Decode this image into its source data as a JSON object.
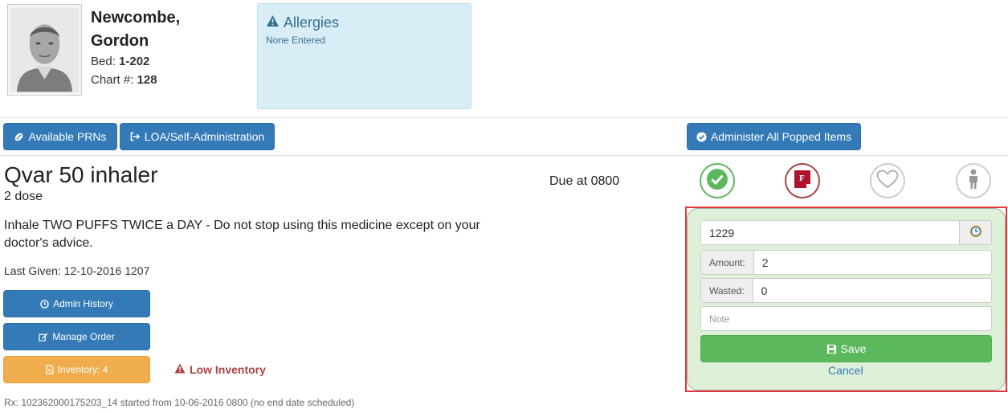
{
  "patient": {
    "last_name": "Newcombe,",
    "first_name": "Gordon",
    "bed_label": "Bed:",
    "bed": "1-202",
    "chart_label": "Chart #:",
    "chart": "128"
  },
  "allergies": {
    "title": "Allergies",
    "text": "None Entered"
  },
  "toolbar": {
    "prn_label": "Available PRNs",
    "loa_label": "LOA/Self-Administration",
    "administer_all_label": "Administer All Popped Items"
  },
  "medication": {
    "name": "Qvar 50 inhaler",
    "dose": "2 dose",
    "instructions": "Inhale TWO PUFFS TWICE a DAY - Do not stop using this medicine except on your doctor's advice.",
    "last_given": "Last Given: 12-10-2016 1207",
    "due": "Due at 0800",
    "admin_history_label": "Admin History",
    "manage_order_label": "Manage Order",
    "inventory_label": "Inventory: 4",
    "low_inventory": "Low Inventory",
    "rx": "Rx: 102362000175203_14 started from 10-06-2016 0800 (no end date scheduled)"
  },
  "status_icons": [
    "check-circle-icon",
    "flag-note-icon",
    "heart-icon",
    "person-icon"
  ],
  "administration": {
    "time_value": "1229",
    "amount_label": "Amount:",
    "amount_value": "2",
    "wasted_label": "Wasted:",
    "wasted_value": "0",
    "note_placeholder": "Note",
    "save_label": "Save",
    "cancel_label": "Cancel"
  },
  "colors": {
    "primary": "#337ab7",
    "success": "#5cb85c",
    "warning": "#f0ad4e",
    "danger": "#a94442",
    "info_bg": "#d9edf7",
    "panel_bg": "#dff0d8",
    "highlight": "#e23a3a"
  }
}
